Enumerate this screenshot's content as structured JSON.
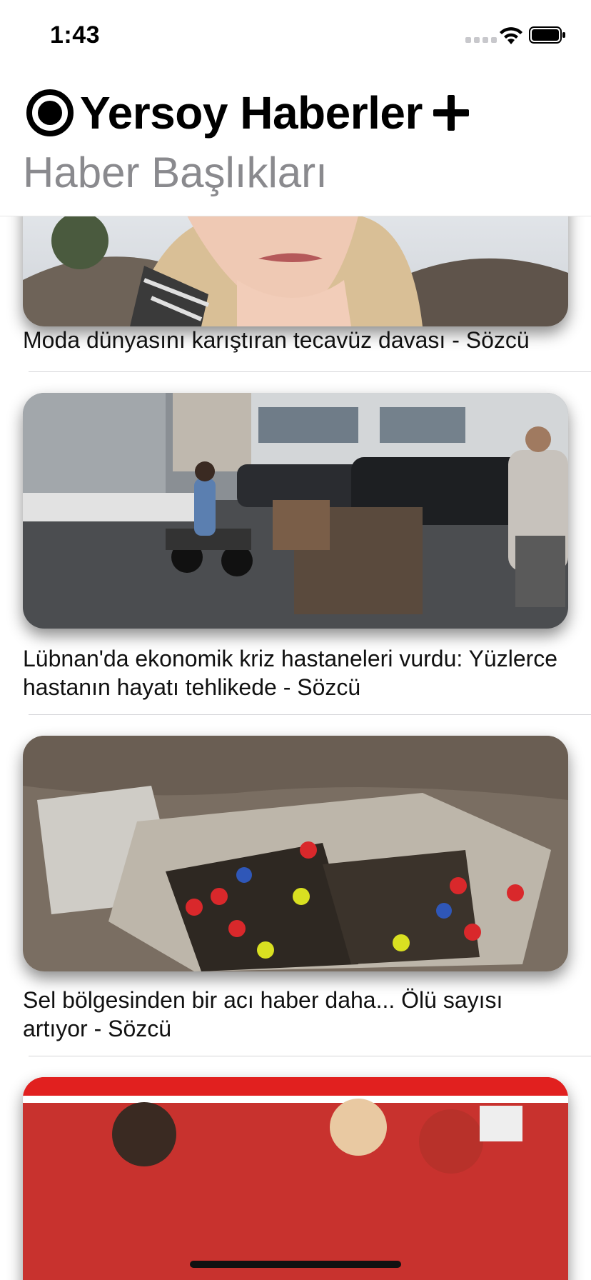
{
  "status_bar": {
    "time": "1:43"
  },
  "header": {
    "app_title": "Yersoy Haberler",
    "subtitle": "Haber Başlıkları",
    "logo_icon": "record-circle-icon",
    "add_icon": "plus-icon"
  },
  "feed": {
    "items": [
      {
        "headline": "Moda dünyasını karıştıran tecavüz davası - Sözcü",
        "image": "woman-portrait-photo"
      },
      {
        "headline": "Lübnan'da ekonomik kriz hastaneleri vurdu: Yüzlerce hastanın hayatı tehlikede - Sözcü",
        "image": "street-scooter-photo"
      },
      {
        "headline": "Sel bölgesinden bir acı haber daha... Ölü sayısı artıyor - Sözcü",
        "image": "rescue-rubble-photo"
      },
      {
        "headline": "",
        "image": "red-banner-photo"
      }
    ]
  },
  "colors": {
    "accent": "#000000",
    "subtitle": "#8a8a8e",
    "separator": "#d5d5d8"
  }
}
